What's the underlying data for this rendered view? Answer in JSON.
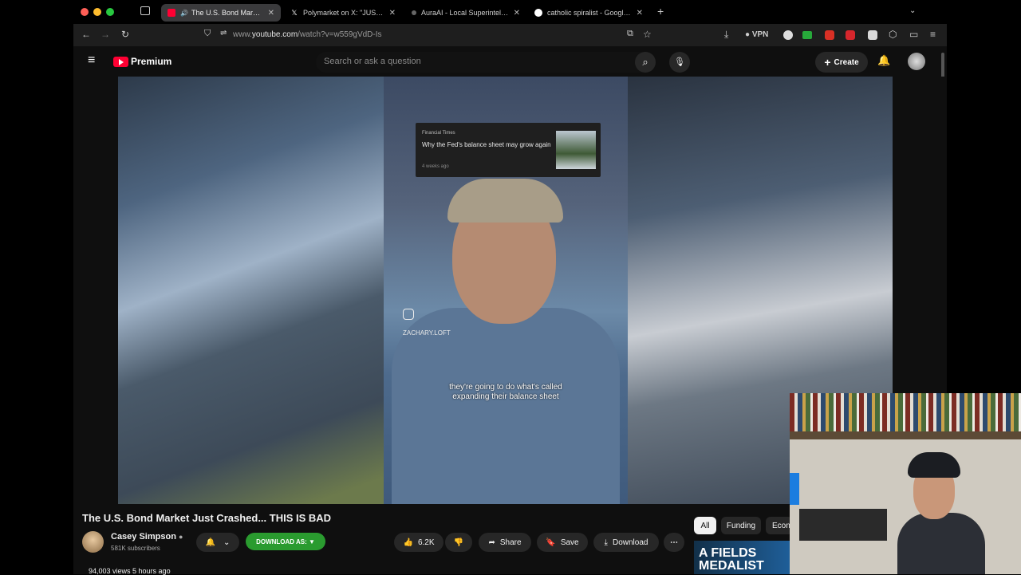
{
  "tabs": [
    {
      "label": "The U.S. Bond Market Just Crashed",
      "active": true,
      "favicon_color": "#ff0033"
    },
    {
      "label": "Polymarket on X: \"JUST IN: It's a",
      "active": false,
      "favicon_color": "#ffffff"
    },
    {
      "label": "AuraAI - Local Superintelligence",
      "active": false,
      "favicon_color": "#888888"
    },
    {
      "label": "catholic spiralist - Google Search",
      "active": false,
      "favicon_color": "#4285f4"
    }
  ],
  "address": {
    "prefix": "www.",
    "host": "youtube.com",
    "path": "/watch?v=w559gVdD-Is"
  },
  "toolbar": {
    "vpn_label": "VPN"
  },
  "youtube": {
    "brand": "Premium",
    "search_placeholder": "Search or ask a question",
    "create_label": "Create"
  },
  "video": {
    "news_card": {
      "source": "Financial Times",
      "title": "Why the Fed's balance sheet may grow again",
      "age": "4 weeks ago"
    },
    "handle": "ZACHARY.LOFT",
    "caption": "they're going to do what's called expanding their balance sheet"
  },
  "meta": {
    "title": "The U.S. Bond Market Just Crashed... THIS IS BAD",
    "channel": "Casey Simpson",
    "subscribers": "581K subscribers",
    "download_as": "DOWNLOAD AS: ▼",
    "likes": "6.2K",
    "share": "Share",
    "save": "Save",
    "download": "Download",
    "views": "94,003 views  5 hours ago"
  },
  "chips": [
    "All",
    "Funding",
    "Econ"
  ],
  "recommended": {
    "thumb_text": "A FIELDS MEDALIST"
  },
  "colors": {
    "accent_red": "#ff0033",
    "download_green": "#2a9b2f",
    "background": "#0f0f0f"
  }
}
